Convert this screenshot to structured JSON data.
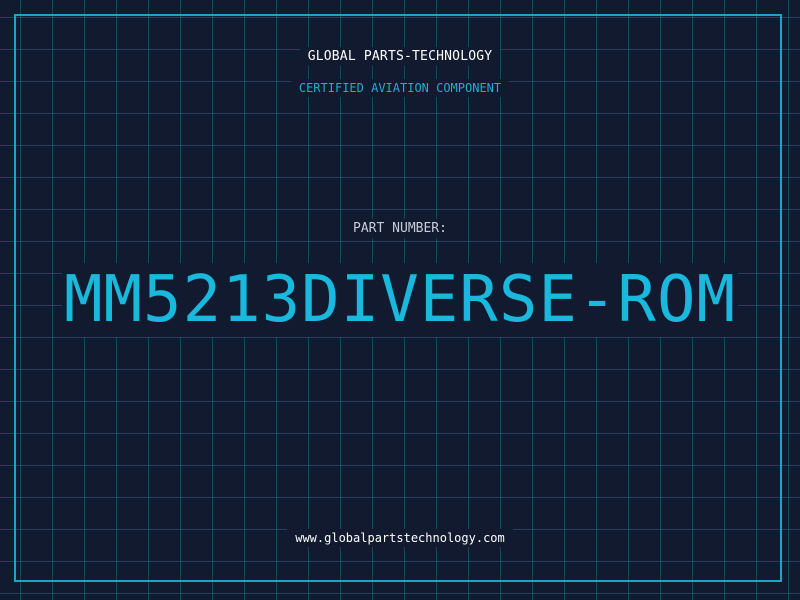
{
  "header": {
    "brand": "GLOBAL PARTS-TECHNOLOGY",
    "subtitle": "CERTIFIED AVIATION COMPONENT"
  },
  "main": {
    "label": "PART NUMBER:",
    "part_number": "MM5213DIVERSE-ROM"
  },
  "footer": {
    "url": "www.globalpartstechnology.com"
  },
  "colors": {
    "background": "#111a2e",
    "grid": "#196e87",
    "accent": "#1ab8dc",
    "frame": "#1ba6c9"
  }
}
